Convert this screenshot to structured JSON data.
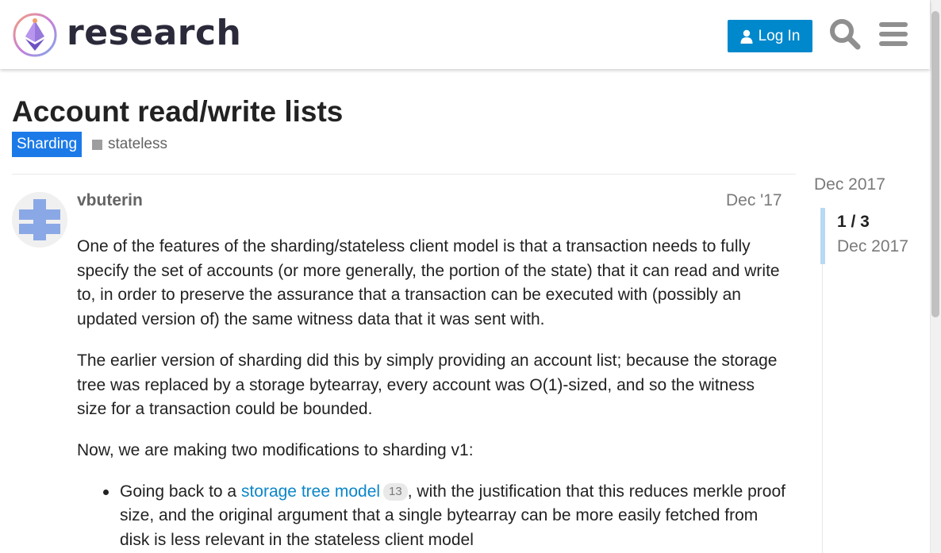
{
  "header": {
    "logo_text": "research",
    "login_label": "Log In"
  },
  "icons": {
    "login": "user-icon",
    "search": "search-icon",
    "menu": "hamburger-menu-icon",
    "logo": "ethereum-logo-icon"
  },
  "colors": {
    "accent": "#0088cc",
    "category": "#1b7ae8",
    "link": "#0b86c9"
  },
  "topic": {
    "title": "Account read/write lists",
    "category": "Sharding",
    "tag": "stateless"
  },
  "post": {
    "username": "vbuterin",
    "date": "Dec '17",
    "paragraphs": [
      "One of the features of the sharding/stateless client model is that a transaction needs to fully specify the set of accounts (or more generally, the portion of the state) that it can read and write to, in order to preserve the assurance that a transaction can be executed with (possibly an updated version of) the same witness data that it was sent with.",
      "The earlier version of sharding did this by simply providing an account list; because the storage tree was replaced by a storage bytearray, every account was O(1)-sized, and so the witness size for a transaction could be bounded.",
      "Now, we are making two modifications to sharding v1:"
    ],
    "bullet": {
      "prefix": "Going back to a ",
      "link_text": "storage tree model",
      "link_clicks": "13",
      "suffix": ", with the justification that this reduces merkle proof size, and the original argument that a single bytearray can be more easily fetched from disk is less relevant in the stateless client model"
    }
  },
  "timeline": {
    "start_date": "Dec 2017",
    "position": "1 / 3",
    "current_date": "Dec 2017"
  }
}
